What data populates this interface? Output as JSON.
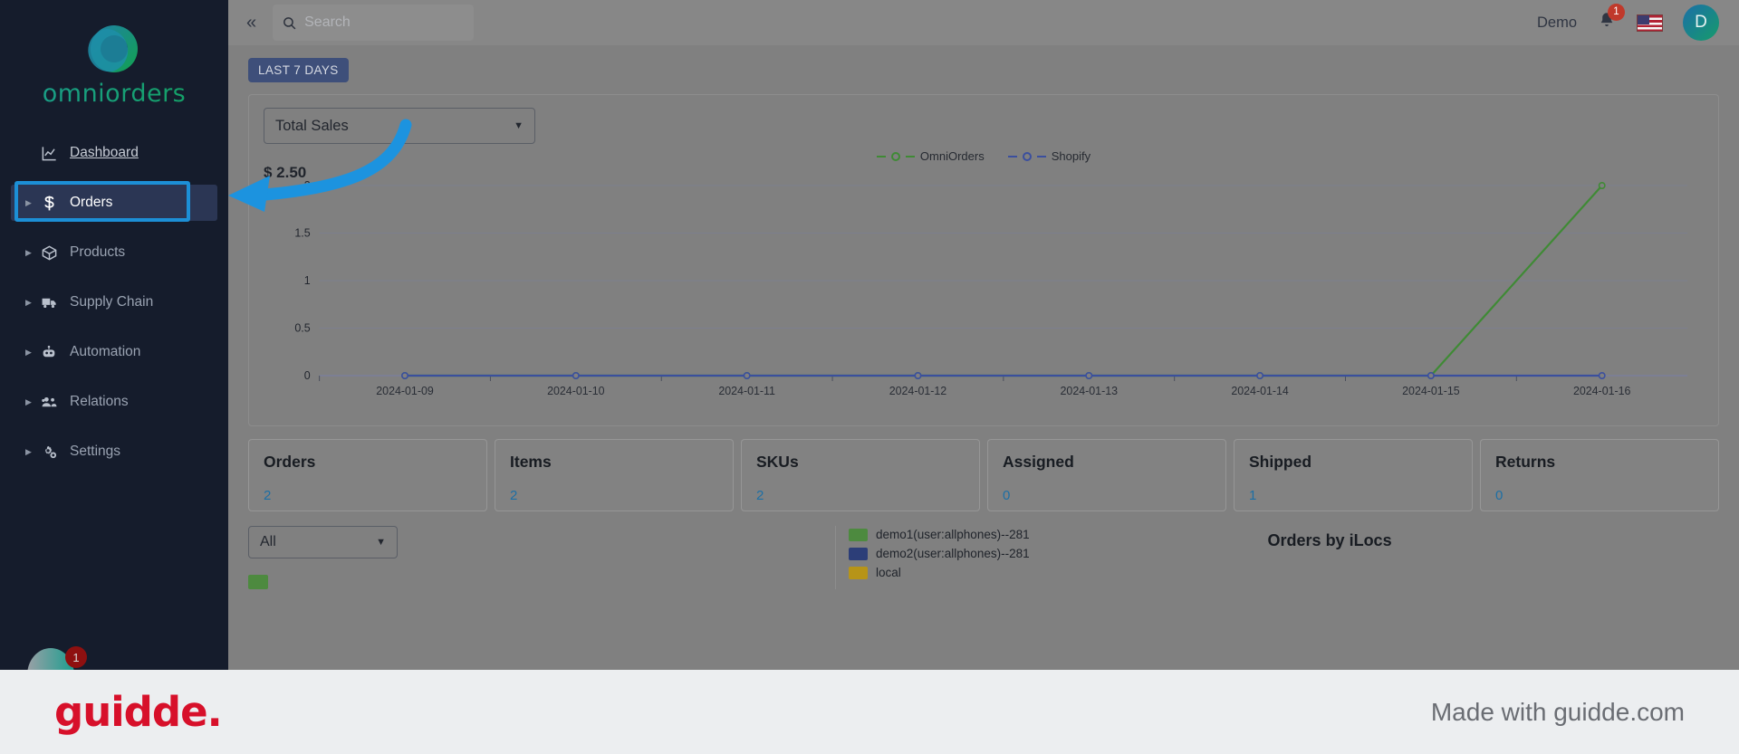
{
  "brand": {
    "name": "omniorders",
    "logo_icon": "omniorders-ring-logo"
  },
  "sidebar": {
    "items": [
      {
        "label": "Dashboard",
        "icon": "chart-line-icon",
        "active": false,
        "expandable": false
      },
      {
        "label": "Orders",
        "icon": "dollar-sign-icon",
        "active": true,
        "expandable": true
      },
      {
        "label": "Products",
        "icon": "box-icon",
        "active": false,
        "expandable": true
      },
      {
        "label": "Supply Chain",
        "icon": "truck-icon",
        "active": false,
        "expandable": true
      },
      {
        "label": "Automation",
        "icon": "robot-icon",
        "active": false,
        "expandable": true
      },
      {
        "label": "Relations",
        "icon": "users-icon",
        "active": false,
        "expandable": true
      },
      {
        "label": "Settings",
        "icon": "gears-icon",
        "active": false,
        "expandable": true
      }
    ],
    "bottom_badge": "1"
  },
  "header": {
    "collapse_icon": "double-chevron-left-icon",
    "search": {
      "placeholder": "Search",
      "value": "",
      "icon": "search-icon"
    },
    "user_label": "Demo",
    "notifications": {
      "icon": "bell-icon",
      "count": "1"
    },
    "language": {
      "icon": "us-flag-icon"
    },
    "avatar_initial": "D"
  },
  "main": {
    "date_range_chip": "LAST 7 DAYS",
    "metric_select": {
      "value": "Total Sales",
      "caret_icon": "chevron-down-icon"
    },
    "kpi_amount": "$ 2.50",
    "cards": [
      {
        "title": "Orders",
        "value": "2"
      },
      {
        "title": "Items",
        "value": "2"
      },
      {
        "title": "SKUs",
        "value": "2"
      },
      {
        "title": "Assigned",
        "value": "0"
      },
      {
        "title": "Shipped",
        "value": "1"
      },
      {
        "title": "Returns",
        "value": "0"
      }
    ],
    "filter_select": {
      "value": "All",
      "caret_icon": "chevron-down-icon"
    },
    "ilocs": {
      "title": "Orders by iLocs",
      "legend": [
        {
          "label": "demo1(user:allphones)--281",
          "color": "#4d8a3f"
        },
        {
          "label": "demo2(user:allphones)--281",
          "color": "#2c3e78"
        },
        {
          "label": "local",
          "color": "#b79418"
        }
      ]
    }
  },
  "annotation": {
    "arrow_color": "#1c93df",
    "highlight_color": "#1c8fd6"
  },
  "footer": {
    "logo_text": "guidde.",
    "right_text": "Made with guidde.com",
    "logo_color": "#d7102a"
  },
  "chart_data": {
    "type": "line",
    "title": "Total Sales",
    "xlabel": "",
    "ylabel": "",
    "x": [
      "2024-01-09",
      "2024-01-10",
      "2024-01-11",
      "2024-01-12",
      "2024-01-13",
      "2024-01-14",
      "2024-01-15",
      "2024-01-16"
    ],
    "yticks": [
      "0",
      "0.5",
      "1",
      "1.5",
      "2"
    ],
    "ylim": [
      0,
      2
    ],
    "grid": true,
    "legend_position": "top-center",
    "series": [
      {
        "name": "OmniOrders",
        "color": "#3f8a35",
        "values": [
          0,
          0,
          0,
          0,
          0,
          0,
          0,
          2
        ]
      },
      {
        "name": "Shopify",
        "color": "#3b4f9e",
        "values": [
          0,
          0,
          0,
          0,
          0,
          0,
          0,
          0
        ]
      }
    ]
  }
}
